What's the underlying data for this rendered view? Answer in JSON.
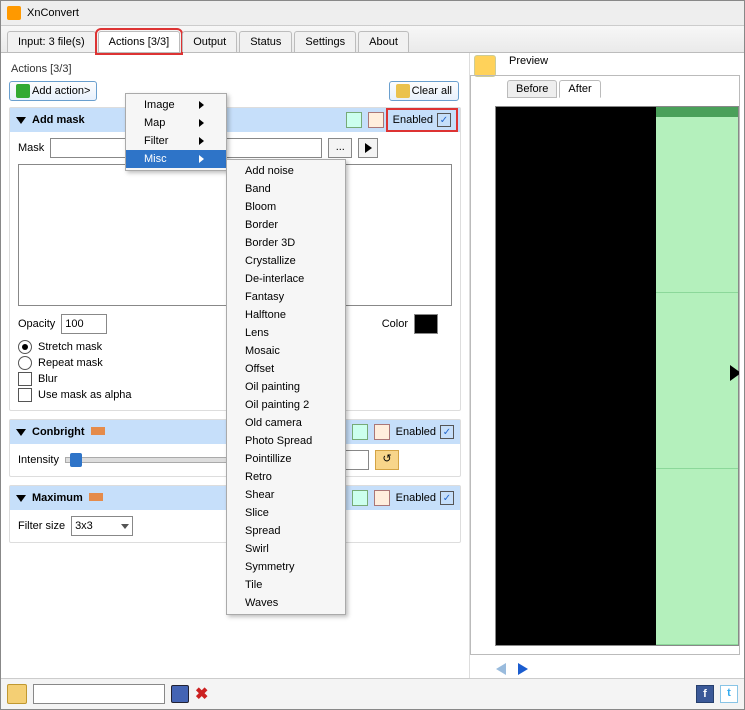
{
  "app_title": "XnConvert",
  "tabs": {
    "input": "Input: 3 file(s)",
    "actions": "Actions [3/3]",
    "output": "Output",
    "status": "Status",
    "settings": "Settings",
    "about": "About"
  },
  "actions_title": "Actions [3/3]",
  "add_action_btn": "Add action>",
  "clear_all_btn": "Clear all",
  "enabled_label": "Enabled",
  "action_addmask": {
    "title": "Add mask",
    "mask_label": "Mask",
    "mask_value": "",
    "browse": "...",
    "opacity_label": "Opacity",
    "opacity_value": "100",
    "color_label": "Color",
    "color_hex": "#000000",
    "stretch": "Stretch mask",
    "repeat": "Repeat mask",
    "blur": "Blur",
    "alpha": "Use mask as alpha",
    "enabled": true
  },
  "action_conbright": {
    "title": "Conbright",
    "intensity_label": "Intensity",
    "number": "0",
    "enabled": true
  },
  "action_maximum": {
    "title": "Maximum",
    "filter_size_label": "Filter size",
    "filter_size_value": "3x3",
    "enabled": true
  },
  "main_menu": [
    {
      "label": "Image",
      "sub": true
    },
    {
      "label": "Map",
      "sub": true
    },
    {
      "label": "Filter",
      "sub": true
    },
    {
      "label": "Misc",
      "sub": true
    }
  ],
  "misc_submenu": [
    "Add noise",
    "Band",
    "Bloom",
    "Border",
    "Border 3D",
    "Crystallize",
    "De-interlace",
    "Fantasy",
    "Halftone",
    "Lens",
    "Mosaic",
    "Offset",
    "Oil painting",
    "Oil painting 2",
    "Old camera",
    "Photo Spread",
    "Pointillize",
    "Retro",
    "Shear",
    "Slice",
    "Spread",
    "Swirl",
    "Symmetry",
    "Tile",
    "Waves"
  ],
  "preview": {
    "title": "Preview",
    "before": "Before",
    "after": "After"
  }
}
